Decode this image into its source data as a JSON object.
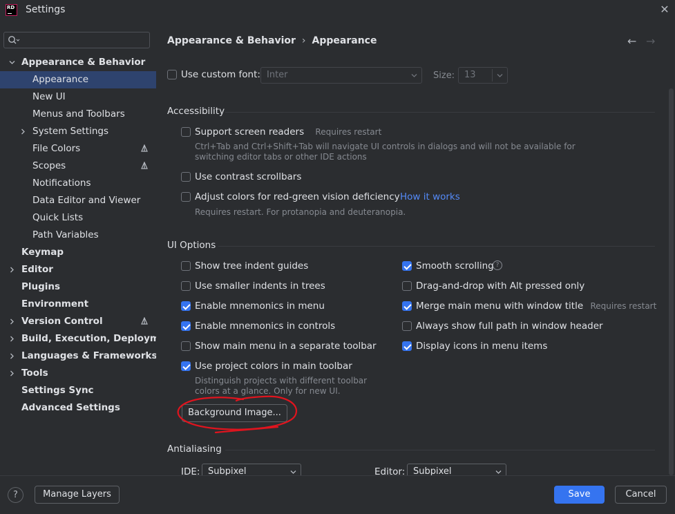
{
  "window": {
    "title": "Settings",
    "logo_text": "RD"
  },
  "sidebar": {
    "search_placeholder": "",
    "items": [
      {
        "label": "Appearance & Behavior",
        "bold": true
      },
      {
        "label": "Appearance"
      },
      {
        "label": "New UI"
      },
      {
        "label": "Menus and Toolbars"
      },
      {
        "label": "System Settings"
      },
      {
        "label": "File Colors"
      },
      {
        "label": "Scopes"
      },
      {
        "label": "Notifications"
      },
      {
        "label": "Data Editor and Viewer"
      },
      {
        "label": "Quick Lists"
      },
      {
        "label": "Path Variables"
      },
      {
        "label": "Keymap",
        "bold": true
      },
      {
        "label": "Editor",
        "bold": true
      },
      {
        "label": "Plugins",
        "bold": true
      },
      {
        "label": "Environment",
        "bold": true
      },
      {
        "label": "Version Control",
        "bold": true
      },
      {
        "label": "Build, Execution, Deployment",
        "bold": true
      },
      {
        "label": "Languages & Frameworks",
        "bold": true
      },
      {
        "label": "Tools",
        "bold": true
      },
      {
        "label": "Settings Sync",
        "bold": true
      },
      {
        "label": "Advanced Settings",
        "bold": true
      }
    ]
  },
  "breadcrumb": {
    "parent": "Appearance & Behavior",
    "separator": "›",
    "current": "Appearance"
  },
  "font": {
    "label": "Use custom font:",
    "value": "Inter",
    "size_label": "Size:",
    "size_value": "13"
  },
  "accessibility": {
    "title": "Accessibility",
    "screen_readers": "Support screen readers",
    "screen_readers_hint": "Requires restart",
    "screen_readers_desc1": "Ctrl+Tab and Ctrl+Shift+Tab will navigate UI controls in dialogs and will not be available for",
    "screen_readers_desc2": "switching editor tabs or other IDE actions",
    "contrast_scrollbars": "Use contrast scrollbars",
    "red_green": "Adjust colors for red-green vision deficiency",
    "how_it_works": "How it works",
    "red_green_hint": "Requires restart. For protanopia and deuteranopia."
  },
  "ui_options": {
    "title": "UI Options",
    "left": [
      {
        "label": "Show tree indent guides",
        "checked": false
      },
      {
        "label": "Use smaller indents in trees",
        "checked": false
      },
      {
        "label": "Enable mnemonics in menu",
        "checked": true
      },
      {
        "label": "Enable mnemonics in controls",
        "checked": true
      },
      {
        "label": "Show main menu in a separate toolbar",
        "checked": false
      },
      {
        "label": "Use project colors in main toolbar",
        "checked": true
      }
    ],
    "right": [
      {
        "label": "Smooth scrolling",
        "checked": true
      },
      {
        "label": "Drag-and-drop with Alt pressed only",
        "checked": false
      },
      {
        "label": "Merge main menu with window title",
        "checked": true
      },
      {
        "label": "Always show full path in window header",
        "checked": false
      },
      {
        "label": "Display icons in menu items",
        "checked": true
      }
    ],
    "merge_hint": "Requires restart",
    "project_colors_desc1": "Distinguish projects with different toolbar",
    "project_colors_desc2": "colors at a glance. Only for new UI.",
    "background_image_button": "Background Image..."
  },
  "antialiasing": {
    "title": "Antialiasing",
    "ide_label": "IDE:",
    "ide_value": "Subpixel",
    "editor_label": "Editor:",
    "editor_value": "Subpixel"
  },
  "footer": {
    "help": "?",
    "manage_layers": "Manage Layers",
    "save": "Save",
    "cancel": "Cancel"
  },
  "colors": {
    "accent": "#3574f0",
    "selection": "#2e436e",
    "link": "#548af7",
    "annotation": "#e0141e"
  }
}
